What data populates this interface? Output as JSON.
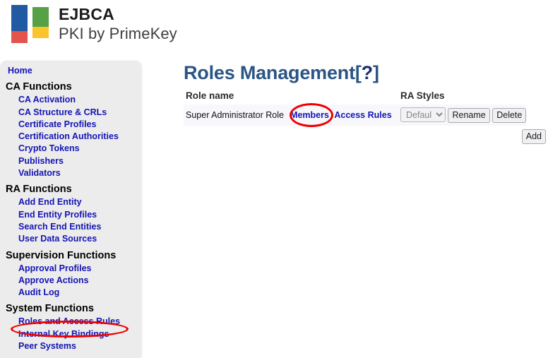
{
  "header": {
    "logo": {
      "title": "EJBCA",
      "subtitle": "PKI by PrimeKey",
      "colors": {
        "blue": "#2159a3",
        "red": "#e2544c",
        "green": "#56a145",
        "yellow": "#fcc42c"
      }
    }
  },
  "sidebar": {
    "home_label": "Home",
    "sections": [
      {
        "heading": "CA Functions",
        "items": [
          "CA Activation",
          "CA Structure & CRLs",
          "Certificate Profiles",
          "Certification Authorities",
          "Crypto Tokens",
          "Publishers",
          "Validators"
        ]
      },
      {
        "heading": "RA Functions",
        "items": [
          "Add End Entity",
          "End Entity Profiles",
          "Search End Entities",
          "User Data Sources"
        ]
      },
      {
        "heading": "Supervision Functions",
        "items": [
          "Approval Profiles",
          "Approve Actions",
          "Audit Log"
        ]
      },
      {
        "heading": "System Functions",
        "items": [
          "Roles and Access Rules",
          "Internal Key Bindings",
          "Peer Systems"
        ]
      }
    ]
  },
  "main": {
    "title": "Roles Management",
    "title_help_open": "[",
    "title_help_mark": "?",
    "title_help_close": "]",
    "table": {
      "headers": {
        "role_name": "Role name",
        "members": "",
        "access_rules": "",
        "ra_styles": "RA Styles"
      },
      "rows": [
        {
          "role_name": "Super Administrator Role",
          "members_link": "Members",
          "access_rules_link": "Access Rules",
          "style_selected": "Default",
          "style_options": [
            "Default"
          ],
          "rename_label": "Rename",
          "delete_label": "Delete"
        }
      ],
      "add_label": "Add"
    }
  },
  "annotations": {
    "accent_color": "#ee0000",
    "highlighted": [
      "Roles and Access Rules",
      "Members"
    ]
  }
}
